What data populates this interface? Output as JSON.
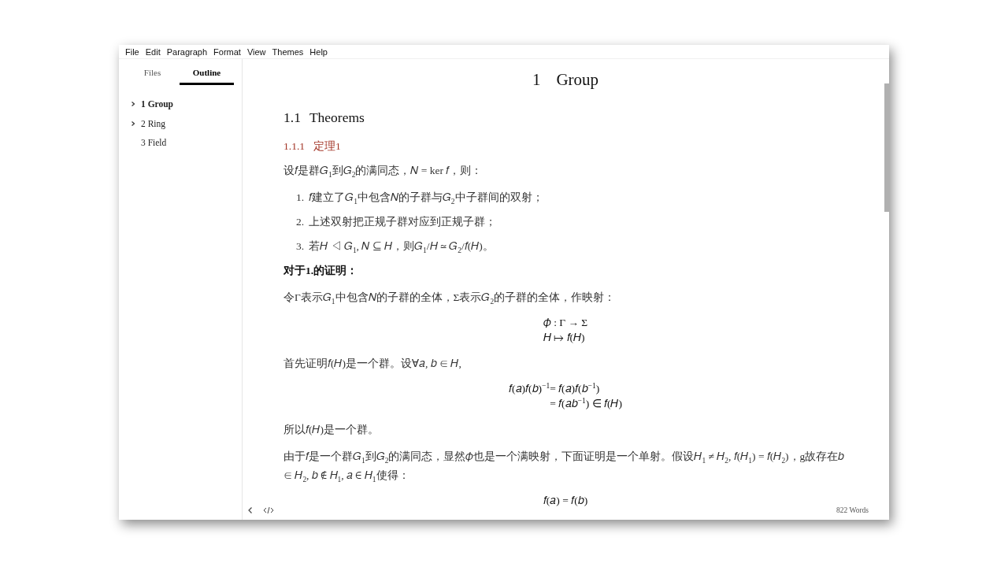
{
  "menu": [
    "File",
    "Edit",
    "Paragraph",
    "Format",
    "View",
    "Themes",
    "Help"
  ],
  "sidebar": {
    "tabs": [
      {
        "label": "Files",
        "selected": false
      },
      {
        "label": "Outline",
        "selected": true
      }
    ],
    "outline": [
      {
        "label": "1 Group",
        "expandable": true,
        "selected": true
      },
      {
        "label": "2 Ring",
        "expandable": true,
        "selected": false
      },
      {
        "label": "3 Field",
        "expandable": false,
        "selected": false
      }
    ]
  },
  "document": [
    {
      "kind": "h1",
      "number": "1",
      "text": "Group"
    },
    {
      "kind": "h2",
      "number": "1.1",
      "text": "Theorems"
    },
    {
      "kind": "h3",
      "number": "1.1.1",
      "text": "定理1"
    },
    {
      "kind": "p",
      "text": "设𝑓是群𝐺$_{1}$到𝐺$_{2}$的满同态，𝑁 = ker 𝑓，则："
    },
    {
      "kind": "ol",
      "items": [
        {
          "number": "1.",
          "text": "𝑓建立了𝐺$_{1}$中包含𝑁的子群与𝐺$_{2}$中子群间的双射；"
        },
        {
          "number": "2.",
          "text": "上述双射把正规子群对应到正规子群；"
        },
        {
          "number": "3.",
          "text": "若𝐻 ◁ 𝐺$_{1}$, 𝑁 ⊆ 𝐻，则𝐺$_{1}$/𝐻 ≃ 𝐺$_{2}$/𝑓(𝐻)。"
        }
      ]
    },
    {
      "kind": "bold",
      "text": "对于1.的证明："
    },
    {
      "kind": "p",
      "text": "令Γ表示𝐺$_{1}$中包含𝑁的子群的全体，Σ表示𝐺$_{2}$的子群的全体，作映射："
    },
    {
      "kind": "display",
      "lines": [
        {
          "rhs": "𝜙 : Γ → Σ"
        },
        {
          "rhs": "𝐻 ↦ 𝑓(𝐻)"
        }
      ]
    },
    {
      "kind": "p",
      "text": "首先证明𝑓(𝐻)是一个群。设∀𝑎, 𝑏 ∈ 𝐻,"
    },
    {
      "kind": "display",
      "lines": [
        {
          "lhs": "𝑓(𝑎)𝑓(𝑏)$^{−1}$",
          "rhs": "= 𝑓(𝑎)𝑓(𝑏$^{−1}$)"
        },
        {
          "rhs": "= 𝑓(𝑎𝑏$^{−1}$) ∈ 𝑓(𝐻)"
        }
      ]
    },
    {
      "kind": "p",
      "text": "所以𝑓(𝐻)是一个群。"
    },
    {
      "kind": "p",
      "text": "由于𝑓是一个群𝐺$_{1}$到𝐺$_{2}$的满同态，显然𝜙也是一个满映射，下面证明是一个单射。假设𝐻$_{1}$ ≠ 𝐻$_{2}$, 𝑓(𝐻$_{1}$) = 𝑓(𝐻$_{2}$)，g故存在𝑏 ∈ 𝐻$_{2}$, 𝑏 ∉ 𝐻$_{1}$, 𝑎 ∈ 𝐻$_{1}$使得："
    },
    {
      "kind": "display",
      "lines": [
        {
          "rhs": "𝑓(𝑎) = 𝑓(𝑏)"
        }
      ]
    }
  ],
  "status_bar": {
    "word_count": "822 Words"
  }
}
